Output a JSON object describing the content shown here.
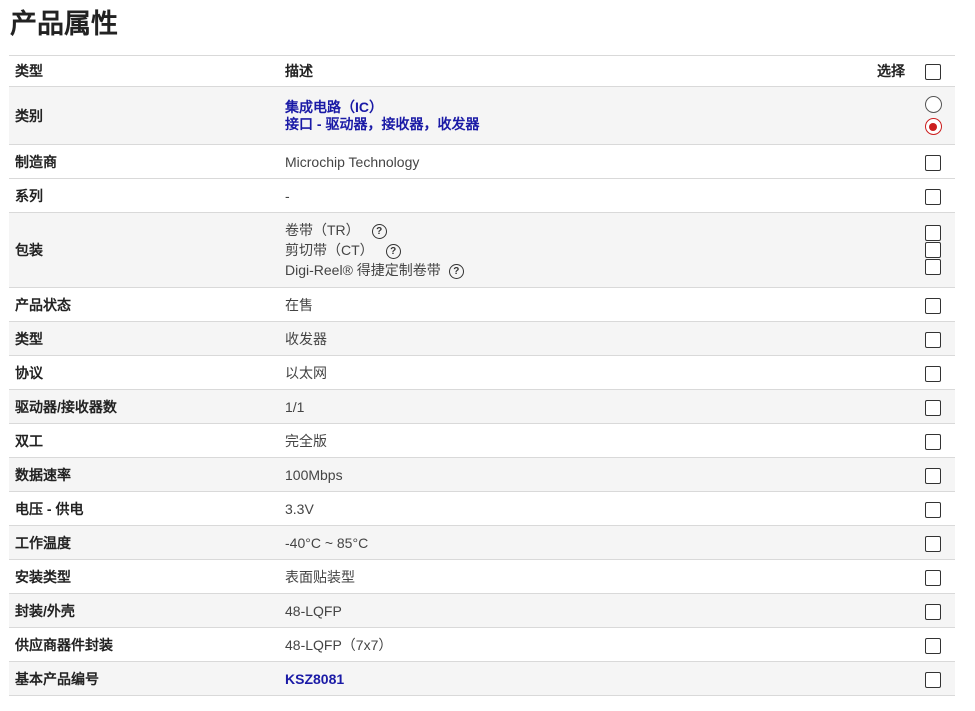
{
  "page": {
    "title": "产品属性"
  },
  "header": {
    "type": "类型",
    "desc": "描述",
    "select": "选择"
  },
  "rows": [
    {
      "label": "类别",
      "lines": [
        "集成电路（IC）",
        "接口 - 驱动器，接收器，收发器"
      ]
    },
    {
      "label": "制造商",
      "value": "Microchip Technology"
    },
    {
      "label": "系列",
      "value": "-"
    },
    {
      "label": "包装",
      "lines": [
        "卷带（TR）",
        "剪切带（CT）",
        "Digi-Reel® 得捷定制卷带"
      ]
    },
    {
      "label": "产品状态",
      "value": "在售"
    },
    {
      "label": "类型",
      "value": "收发器"
    },
    {
      "label": "协议",
      "value": "以太网"
    },
    {
      "label": "驱动器/接收器数",
      "value": "1/1"
    },
    {
      "label": "双工",
      "value": "完全版"
    },
    {
      "label": "数据速率",
      "value": "100Mbps"
    },
    {
      "label": "电压 - 供电",
      "value": "3.3V"
    },
    {
      "label": "工作温度",
      "value": "-40°C ~ 85°C"
    },
    {
      "label": "安装类型",
      "value": "表面贴装型"
    },
    {
      "label": "封装/外壳",
      "value": "48-LQFP"
    },
    {
      "label": "供应商器件封装",
      "value": "48-LQFP（7x7）"
    },
    {
      "label": "基本产品编号",
      "value": "KSZ8081"
    }
  ],
  "icons": {
    "help": "help-question-icon",
    "help_glyph": "?"
  },
  "colors": {
    "link": "#1a1aa6",
    "radio_selected": "#cc1f1f",
    "row_alt": "#f5f5f5"
  }
}
